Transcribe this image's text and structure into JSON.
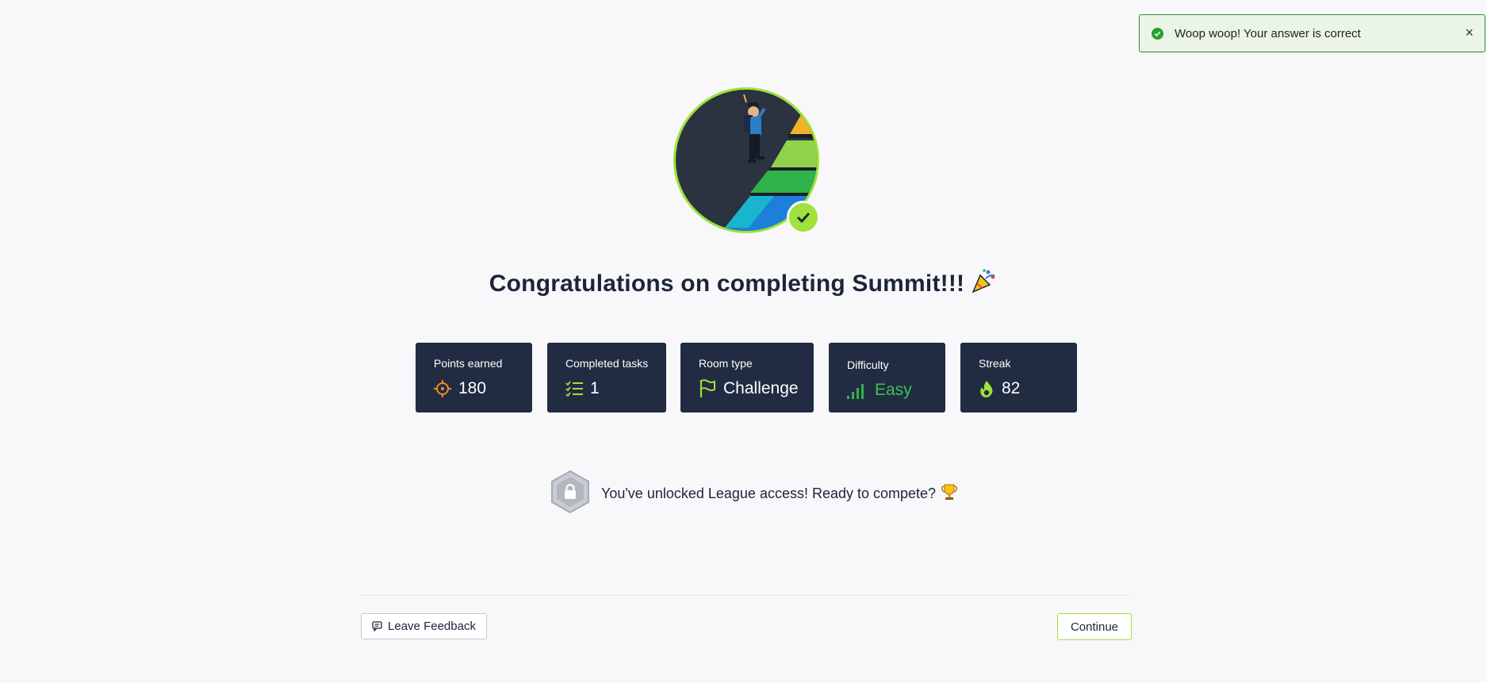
{
  "toast": {
    "message": "Woop woop! Your answer is correct",
    "close": "×"
  },
  "heading": {
    "title": "Congratulations on completing Summit!!!",
    "emoji": "party-popper-icon"
  },
  "stats": [
    {
      "label": "Points earned",
      "value": "180",
      "icon": "crosshair-icon"
    },
    {
      "label": "Completed tasks",
      "value": "1",
      "icon": "checklist-icon"
    },
    {
      "label": "Room type",
      "value": "Challenge",
      "icon": "flag-icon"
    },
    {
      "label": "Difficulty",
      "value": "Easy",
      "icon": "signal-bars-icon"
    },
    {
      "label": "Streak",
      "value": "82",
      "icon": "flame-icon"
    }
  ],
  "league": {
    "text": "You've unlocked League access! Ready to compete?",
    "icon": "lock-badge-icon",
    "emoji": "trophy-icon"
  },
  "footer": {
    "feedback_label": "Leave Feedback",
    "continue_label": "Continue"
  },
  "colors": {
    "accent": "#9ee23a",
    "card_bg": "#212c42",
    "success": "#27a02f",
    "easy": "#3cc251",
    "orange": "#f58a1f"
  }
}
